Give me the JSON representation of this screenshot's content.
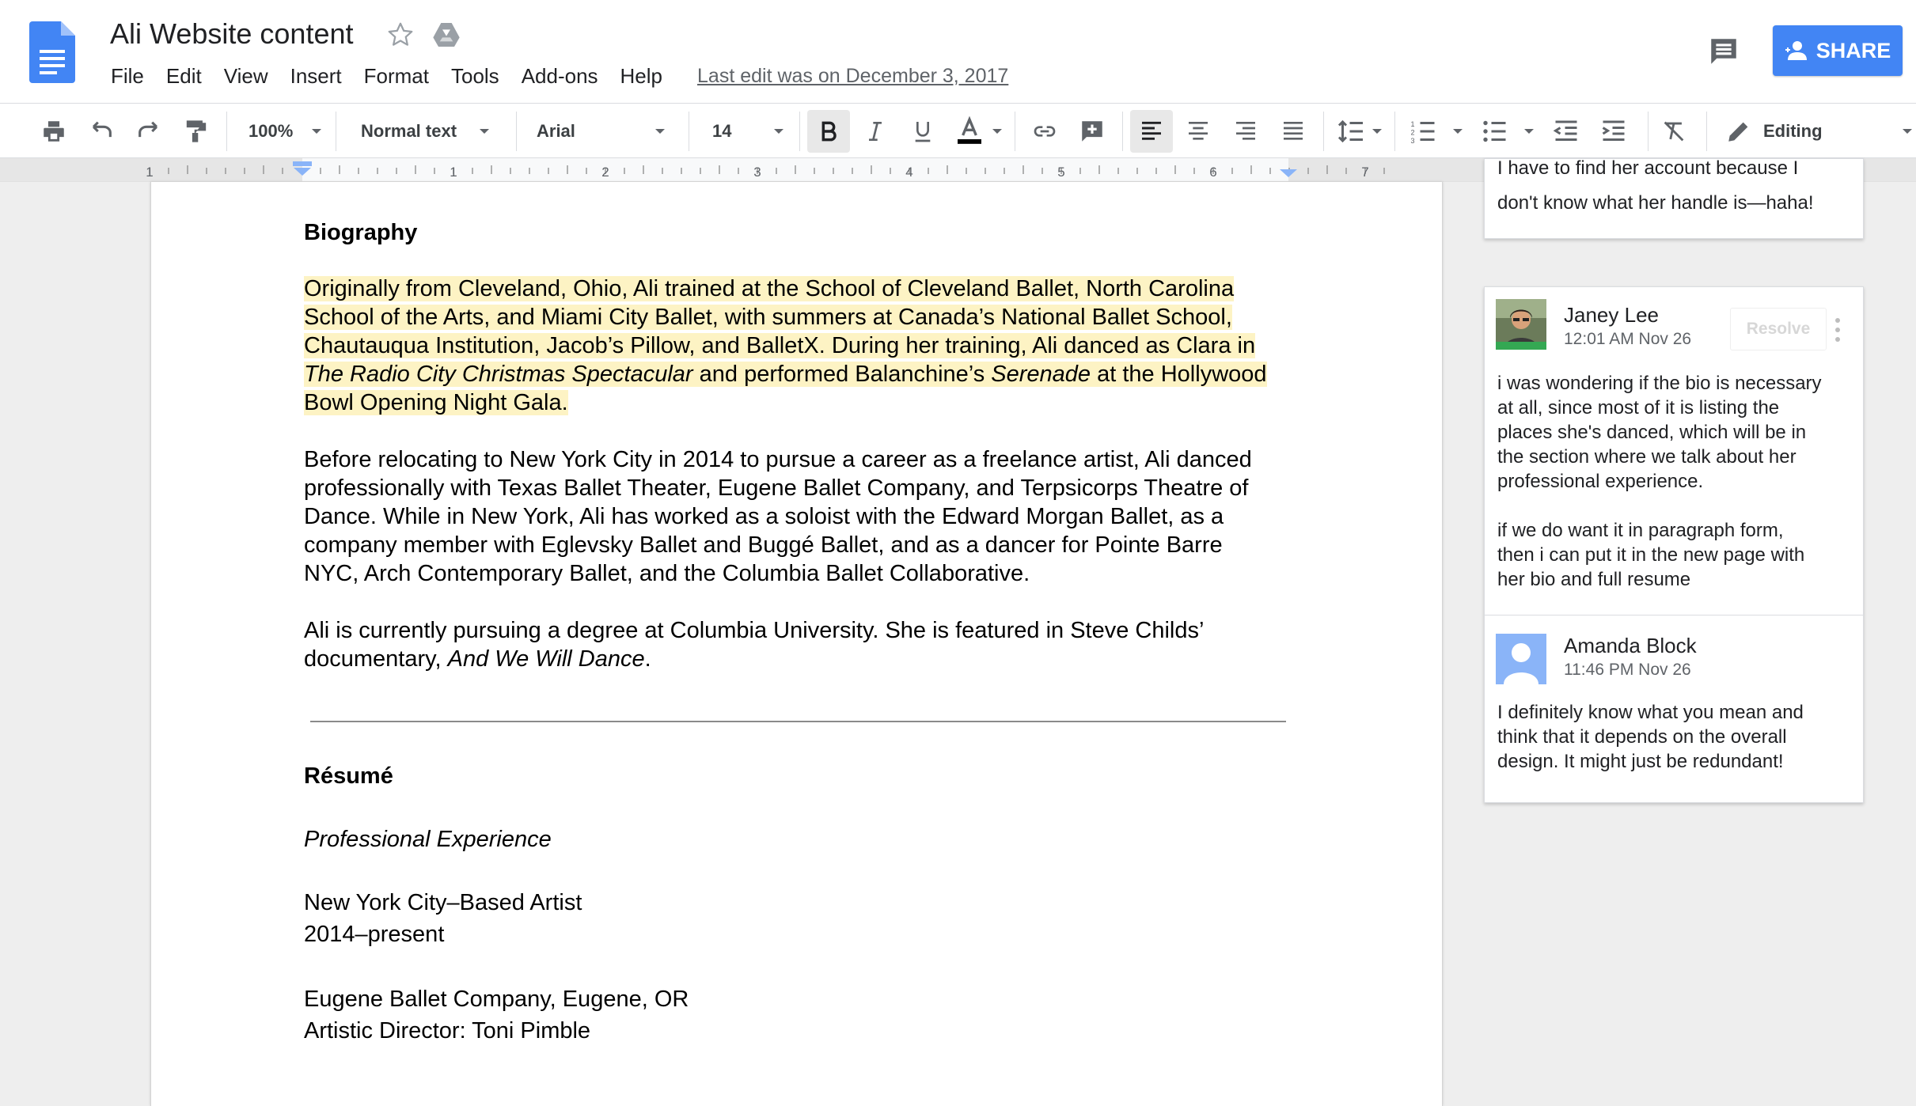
{
  "header": {
    "doc_title": "Ali Website content",
    "menu": [
      "File",
      "Edit",
      "View",
      "Insert",
      "Format",
      "Tools",
      "Add-ons",
      "Help"
    ],
    "last_edit": "Last edit was on December 3, 2017",
    "share_label": "SHARE"
  },
  "toolbar": {
    "zoom": "100%",
    "style": "Normal text",
    "font": "Arial",
    "font_size": "14",
    "mode": "Editing"
  },
  "ruler": {
    "labels": [
      "1",
      "1",
      "2",
      "3",
      "4",
      "5",
      "6",
      "7"
    ]
  },
  "document": {
    "heading_bio": "Biography",
    "p1": {
      "line1": "Originally from Cleveland, Ohio, Ali trained at the School of Cleveland Ballet, North Carolina",
      "line2": "School of the Arts, and Miami City Ballet, with summers at Canada’s National Ballet School,",
      "line3": "Chautauqua Institution, Jacob’s Pillow, and BalletX. During her training, Ali danced as Clara in",
      "line4_italic_a": "The Radio City Christmas Spectacular",
      "line4_b": " and performed Balanchine’s ",
      "line4_italic_c": "Serenade",
      "line4_d": " at the Hollywood",
      "line5": "Bowl Opening Night Gala."
    },
    "p2": [
      "Before relocating to New York City in 2014 to pursue a career as a freelance artist, Ali danced",
      "professionally with Texas Ballet Theater, Eugene Ballet Company, and Terpsicorps Theatre of",
      "Dance. While in New York, Ali has worked as a soloist with the Edward Morgan Ballet, as a",
      "company member with Eglevsky Ballet and Buggé Ballet, and as a dancer for Pointe Barre",
      "NYC, Arch Contemporary Ballet, and the Columbia Ballet Collaborative."
    ],
    "p3": {
      "line1": "Ali is currently pursuing a degree at Columbia University. She is featured in Steve Childs’",
      "line2_a": "documentary, ",
      "line2_italic": "And We Will Dance",
      "line2_c": "."
    },
    "heading_resume": "Résumé",
    "subheading": "Professional Experience",
    "entry1": [
      "New York City–Based Artist",
      "2014–present"
    ],
    "entry2": [
      "Eugene Ballet Company, Eugene, OR",
      "Artistic Director: Toni Pimble"
    ]
  },
  "comments": {
    "previous": {
      "line1": "I have to find her account because I",
      "line2": "don't know what her handle is—haha!"
    },
    "thread": {
      "resolve_label": "Resolve",
      "first": {
        "author": "Janey Lee",
        "time": "12:01 AM Nov 26",
        "lines": [
          "i was wondering if the bio is necessary",
          "at all, since most of it is listing the",
          "places she's danced, which will be in",
          "the section where we talk about her",
          "professional experience.",
          "",
          "if we do want it in paragraph form,",
          "then i can put it in the new page with",
          "her bio and full resume"
        ]
      },
      "reply": {
        "author": "Amanda Block",
        "time": "11:46 PM Nov 26",
        "lines": [
          "I definitely know what you mean and",
          "think that it depends on the overall",
          "design. It might just be redundant!"
        ]
      }
    }
  },
  "colors": {
    "brand_blue": "#4285f4",
    "highlight": "#fdf3c4",
    "avatar_placeholder": "#8ab4f8"
  },
  "icons": [
    "docs-logo-icon",
    "star-icon",
    "drive-icon",
    "comments-icon",
    "person-icon",
    "print-icon",
    "undo-icon",
    "redo-icon",
    "paint-format-icon",
    "bold-icon",
    "italic-icon",
    "underline-icon",
    "text-color-icon",
    "link-icon",
    "add-comment-icon",
    "align-left-icon",
    "align-center-icon",
    "align-right-icon",
    "justify-icon",
    "line-spacing-icon",
    "numbered-list-icon",
    "bulleted-list-icon",
    "decrease-indent-icon",
    "increase-indent-icon",
    "clear-formatting-icon",
    "pencil-icon",
    "more-vert-icon"
  ]
}
